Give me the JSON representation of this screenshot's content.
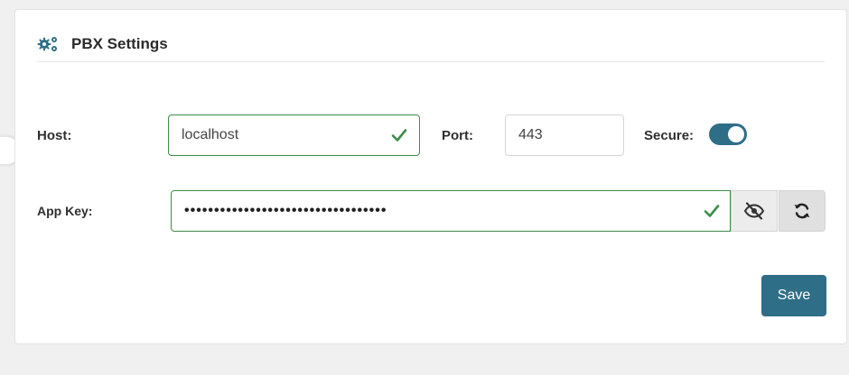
{
  "panel": {
    "title": "PBX Settings",
    "icon": "gears-icon"
  },
  "form": {
    "host_label": "Host:",
    "host_value": "localhost",
    "port_label": "Port:",
    "port_value": "443",
    "secure_label": "Secure:",
    "secure_on": true,
    "app_key_label": "App Key:",
    "app_key_value": "••••••••••••••••••••••••••••••••••"
  },
  "actions": {
    "save_label": "Save"
  },
  "colors": {
    "accent": "#2e6e87",
    "valid": "#3d8c4a"
  }
}
